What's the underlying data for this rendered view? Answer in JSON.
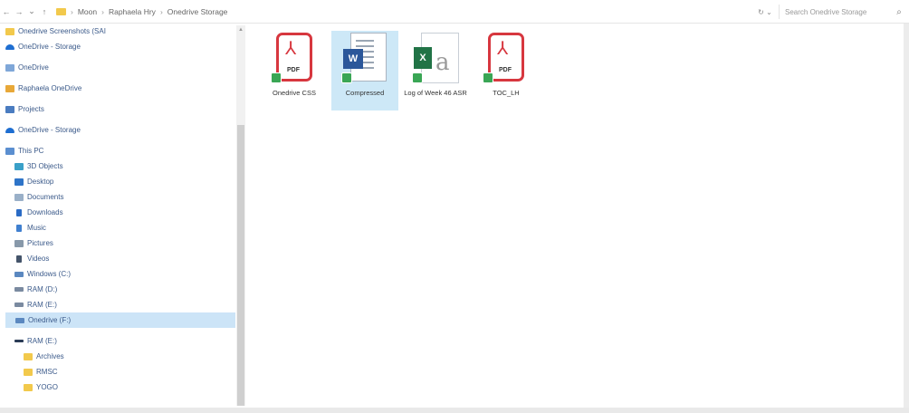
{
  "address": {
    "back_glyph": "←",
    "forward_glyph": "→",
    "up_glyph": "↑",
    "dropdown_glyph": "⌄",
    "breadcrumbs": [
      "Moon",
      "Raphaela Hry",
      "Onedrive Storage"
    ],
    "refresh_glyph": "↻ ⌄",
    "search_placeholder": "Search Onedrive Storage",
    "search_glyph": "⌕"
  },
  "sidebar": {
    "items": [
      {
        "label": "Onedrive Screenshots (SAI",
        "icon": "folder-icon"
      },
      {
        "label": "OneDrive - Storage",
        "icon": "cloud-icon"
      },
      {
        "label": "OneDrive",
        "icon": "onedrive-icon"
      },
      {
        "label": "Raphaela OneDrive",
        "icon": "people-icon"
      },
      {
        "label": "Projects",
        "icon": "projects-icon"
      },
      {
        "label": "OneDrive - Storage",
        "icon": "cloud-icon"
      },
      {
        "label": "This PC",
        "icon": "pc-icon"
      },
      {
        "label": "3D Objects",
        "icon": "3d-objects-icon"
      },
      {
        "label": "Desktop",
        "icon": "desktop-icon"
      },
      {
        "label": "Documents",
        "icon": "documents-icon"
      },
      {
        "label": "Downloads",
        "icon": "downloads-icon"
      },
      {
        "label": "Music",
        "icon": "music-icon"
      },
      {
        "label": "Pictures",
        "icon": "pictures-icon"
      },
      {
        "label": "Videos",
        "icon": "videos-icon"
      },
      {
        "label": "Windows (C:)",
        "icon": "drive-icon"
      },
      {
        "label": "RAM (D:)",
        "icon": "network-icon"
      },
      {
        "label": "RAM (E:)",
        "icon": "network-icon"
      },
      {
        "label": "Onedrive (F:)",
        "icon": "drive-icon"
      },
      {
        "label": "RAM (E:)",
        "icon": "dark-drive-icon"
      },
      {
        "label": "Archives",
        "icon": "folder-icon"
      },
      {
        "label": "RMSC",
        "icon": "folder-icon"
      },
      {
        "label": "YOGO",
        "icon": "folder-icon"
      }
    ],
    "selected_index": 17
  },
  "scrollbar": {
    "up_glyph": "▲",
    "down_glyph": "▼"
  },
  "files": [
    {
      "name": "Onedrive CSS",
      "type": "pdf",
      "badge": "PDF",
      "logo": "⅄"
    },
    {
      "name": "Compressed",
      "type": "word",
      "badge": "W",
      "selected": true
    },
    {
      "name": "Log of Week 46 ASR",
      "type": "excel",
      "badge": "X",
      "glyph": "a"
    },
    {
      "name": "TOC_LH",
      "type": "pdf",
      "badge": "PDF",
      "logo": "⅄"
    }
  ]
}
